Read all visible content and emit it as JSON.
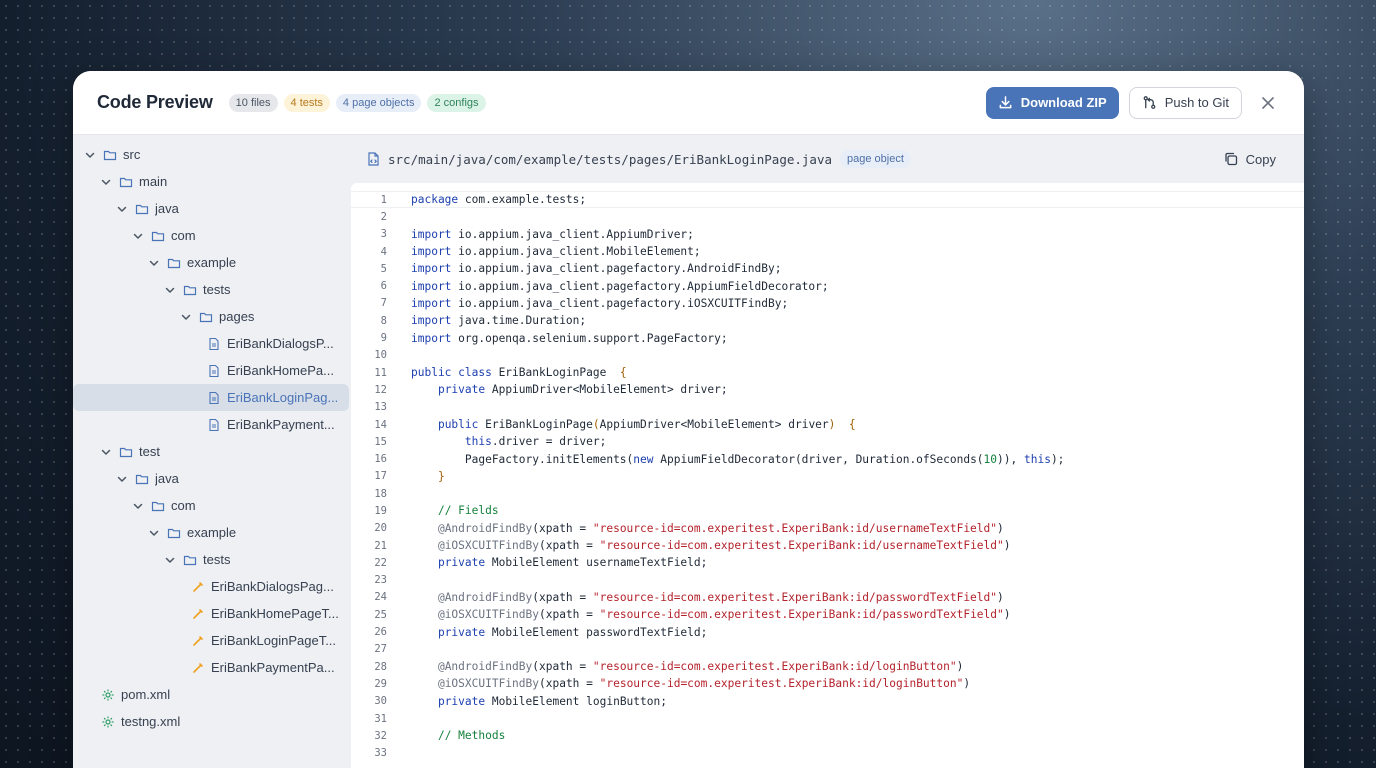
{
  "header": {
    "title": "Code Preview",
    "badges": [
      "10 files",
      "4 tests",
      "4 page objects",
      "2 configs"
    ],
    "download_label": "Download ZIP",
    "git_label": "Push to Git"
  },
  "colors": {
    "accent": "#4a74b8",
    "test_icon": "#f0a020",
    "config_icon": "#2f9e6a"
  },
  "tree": [
    {
      "label": "src",
      "depth": 0,
      "type": "folder"
    },
    {
      "label": "main",
      "depth": 1,
      "type": "folder"
    },
    {
      "label": "java",
      "depth": 2,
      "type": "folder"
    },
    {
      "label": "com",
      "depth": 3,
      "type": "folder"
    },
    {
      "label": "example",
      "depth": 4,
      "type": "folder"
    },
    {
      "label": "tests",
      "depth": 5,
      "type": "folder"
    },
    {
      "label": "pages",
      "depth": 6,
      "type": "folder"
    },
    {
      "label": "EriBankDialogsP...",
      "depth": 7,
      "type": "page"
    },
    {
      "label": "EriBankHomePa...",
      "depth": 7,
      "type": "page"
    },
    {
      "label": "EriBankLoginPag...",
      "depth": 7,
      "type": "page",
      "selected": true
    },
    {
      "label": "EriBankPayment...",
      "depth": 7,
      "type": "page"
    },
    {
      "label": "test",
      "depth": 1,
      "type": "folder"
    },
    {
      "label": "java",
      "depth": 2,
      "type": "folder"
    },
    {
      "label": "com",
      "depth": 3,
      "type": "folder"
    },
    {
      "label": "example",
      "depth": 4,
      "type": "folder"
    },
    {
      "label": "tests",
      "depth": 5,
      "type": "folder"
    },
    {
      "label": "EriBankDialogsPag...",
      "depth": 6,
      "type": "test"
    },
    {
      "label": "EriBankHomePageT...",
      "depth": 6,
      "type": "test"
    },
    {
      "label": "EriBankLoginPageT...",
      "depth": 6,
      "type": "test"
    },
    {
      "label": "EriBankPaymentPa...",
      "depth": 6,
      "type": "test"
    },
    {
      "label": "pom.xml",
      "depth": 1,
      "type": "config"
    },
    {
      "label": "testng.xml",
      "depth": 1,
      "type": "config"
    }
  ],
  "file": {
    "path": "src/main/java/com/example/tests/pages/EriBankLoginPage.java",
    "badge": "page object",
    "copy_label": "Copy"
  },
  "code_lines": [
    "<k>package</k> com.example.tests;",
    "",
    "<k>import</k> io.appium.java_client.AppiumDriver;",
    "<k>import</k> io.appium.java_client.MobileElement;",
    "<k>import</k> io.appium.java_client.pagefactory.AndroidFindBy;",
    "<k>import</k> io.appium.java_client.pagefactory.AppiumFieldDecorator;",
    "<k>import</k> io.appium.java_client.pagefactory.iOSXCUITFindBy;",
    "<k>import</k> java.time.Duration;",
    "<k>import</k> org.openqa.selenium.support.PageFactory;",
    "",
    "<k>public class</k> EriBankLoginPage  <b>{</b>",
    "    <k>private</k> AppiumDriver&lt;MobileElement&gt; driver;",
    "",
    "    <k>public</k> EriBankLoginPage<b>(</b>AppiumDriver&lt;MobileElement&gt; driver<b>)</b>  <b>{</b>",
    "        <k>this</k>.driver = driver;",
    "        PageFactory.initElements(<k>new</k> AppiumFieldDecorator(driver, Duration.ofSeconds(<n>10</n>)), <k>this</k>);",
    "    <b>}</b>",
    "",
    "    <c>// Fields</c>",
    "    <a>@AndroidFindBy</a>(xpath = <s>\"resource-id=com.experitest.ExperiBank:id/usernameTextField\"</s>)",
    "    <a>@iOSXCUITFindBy</a>(xpath = <s>\"resource-id=com.experitest.ExperiBank:id/usernameTextField\"</s>)",
    "    <k>private</k> MobileElement usernameTextField;",
    "",
    "    <a>@AndroidFindBy</a>(xpath = <s>\"resource-id=com.experitest.ExperiBank:id/passwordTextField\"</s>)",
    "    <a>@iOSXCUITFindBy</a>(xpath = <s>\"resource-id=com.experitest.ExperiBank:id/passwordTextField\"</s>)",
    "    <k>private</k> MobileElement passwordTextField;",
    "",
    "    <a>@AndroidFindBy</a>(xpath = <s>\"resource-id=com.experitest.ExperiBank:id/loginButton\"</s>)",
    "    <a>@iOSXCUITFindBy</a>(xpath = <s>\"resource-id=com.experitest.ExperiBank:id/loginButton\"</s>)",
    "    <k>private</k> MobileElement loginButton;",
    "",
    "    <c>// Methods</c>",
    ""
  ]
}
